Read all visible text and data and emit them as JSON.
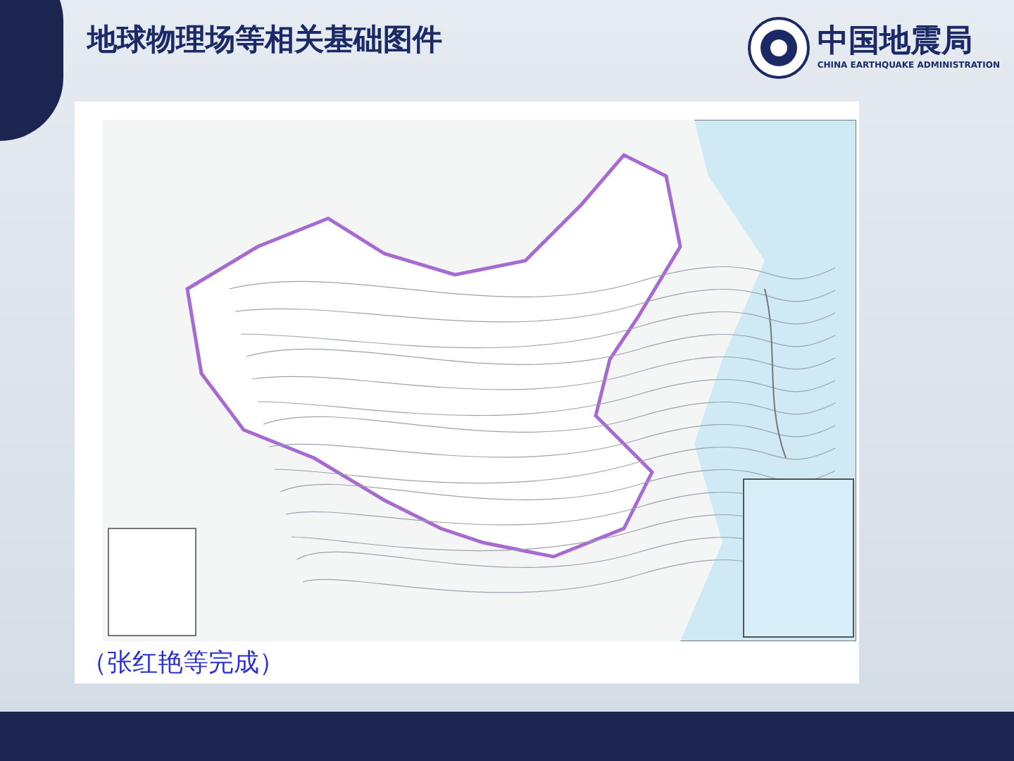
{
  "slide": {
    "title": "地球物理场等相关基础图件",
    "caption": "（张红艳等完成）"
  },
  "logo": {
    "name": "中国地震局",
    "subtitle": "CHINA EARTHQUAKE ADMINISTRATION"
  }
}
